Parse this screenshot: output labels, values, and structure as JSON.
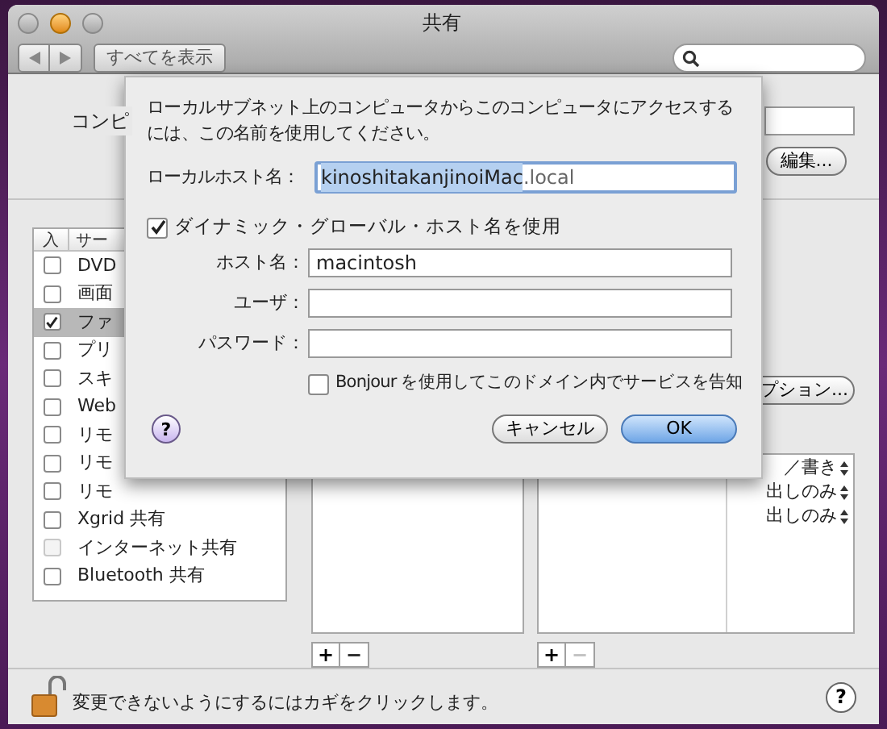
{
  "window": {
    "title": "共有",
    "show_all_button": "すべてを表示"
  },
  "computer_name": {
    "label": "コンピ",
    "edit_button": "編集..."
  },
  "services": {
    "columns": [
      "入",
      "サー"
    ],
    "rows": [
      {
        "name": "DVD",
        "checked": false,
        "selected": false,
        "disabled": false
      },
      {
        "name": "画面",
        "checked": false,
        "selected": false,
        "disabled": false
      },
      {
        "name": "ファ",
        "checked": true,
        "selected": true,
        "disabled": false
      },
      {
        "name": "プリ",
        "checked": false,
        "selected": false,
        "disabled": false
      },
      {
        "name": "スキ",
        "checked": false,
        "selected": false,
        "disabled": false
      },
      {
        "name": "Web",
        "checked": false,
        "selected": false,
        "disabled": false
      },
      {
        "name": "リモ",
        "checked": false,
        "selected": false,
        "disabled": false
      },
      {
        "name": "リモ",
        "checked": false,
        "selected": false,
        "disabled": false
      },
      {
        "name": "リモ",
        "checked": false,
        "selected": false,
        "disabled": false
      },
      {
        "name": "Xgrid 共有",
        "checked": false,
        "selected": false,
        "disabled": false
      },
      {
        "name": "インターネット共有",
        "checked": false,
        "selected": false,
        "disabled": true
      },
      {
        "name": "Bluetooth 共有",
        "checked": false,
        "selected": false,
        "disabled": false
      }
    ]
  },
  "options_button": "プション...",
  "permissions": [
    "／書き",
    "出しのみ",
    "出しのみ"
  ],
  "list_buttons": [
    {
      "add": "+",
      "remove": "−",
      "remove_disabled": false
    },
    {
      "add": "+",
      "remove": "−",
      "remove_disabled": true
    }
  ],
  "sheet": {
    "message": "ローカルサブネット上のコンピュータからこのコンピュータにアクセスするには、この名前を使用してください。",
    "local_hostname": {
      "label": "ローカルホスト名：",
      "selected_text": "kinoshitakanjinoiMac",
      "suffix": ".local"
    },
    "dynamic_dns": {
      "label": "ダイナミック・グローバル・ホスト名を使用",
      "checked": true
    },
    "fields": [
      {
        "label": "ホスト名：",
        "value": "macintosh"
      },
      {
        "label": "ユーザ："
      },
      {
        "label": "パスワード："
      }
    ],
    "bonjour": {
      "label": "Bonjour を使用してこのドメイン内でサービスを告知",
      "checked": false
    },
    "help": "?",
    "cancel_button": "キャンセル",
    "ok_button": "OK"
  },
  "footer": {
    "lock_text": "変更できないようにするにはカギをクリックします。",
    "help": "?"
  }
}
